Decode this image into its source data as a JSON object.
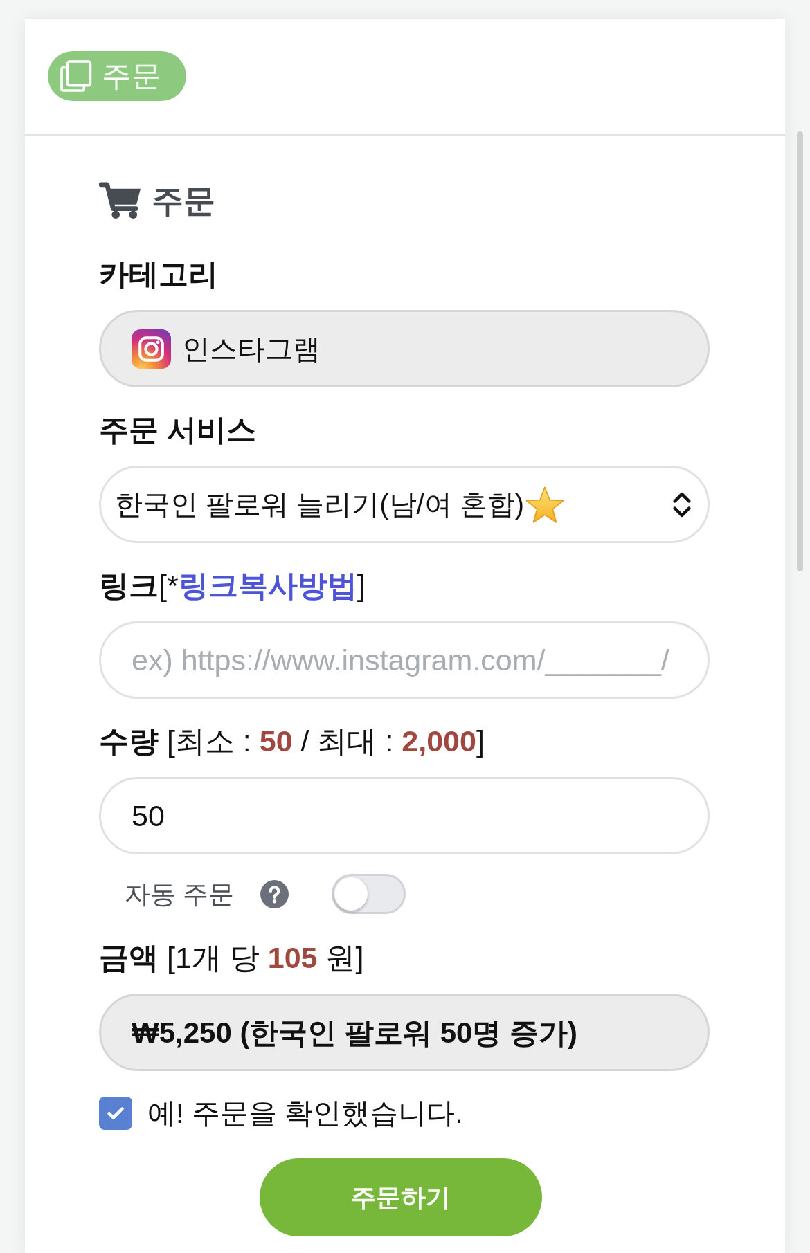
{
  "header": {
    "tab": {
      "label": "주문"
    }
  },
  "title": "주문",
  "form": {
    "category": {
      "label": "카테고리",
      "value": "인스타그램",
      "readonly": true
    },
    "service": {
      "label": "주문 서비스",
      "value": "한국인 팔로워 늘리기(남/여 혼합)",
      "starred": true
    },
    "link": {
      "label": "링크",
      "note_open": "[*",
      "note_link": "링크복사방법",
      "note_close": "]",
      "placeholder": "ex) https://www.instagram.com/_______/"
    },
    "quantity": {
      "label": "수량",
      "note": "[최소 : **50** / 최대 : **2,000**]",
      "value": "50"
    },
    "auto_order": {
      "label": "자동 주문",
      "on": false
    },
    "price": {
      "label": "금액",
      "note": "[1개 당 **105** 원]",
      "total": "₩5,250 (한국인 팔로워 50명 증가)",
      "readonly": true
    },
    "confirm": {
      "label": "예! 주문을 확인했습니다.",
      "checked": true
    },
    "submit": {
      "label": "주문하기"
    }
  }
}
